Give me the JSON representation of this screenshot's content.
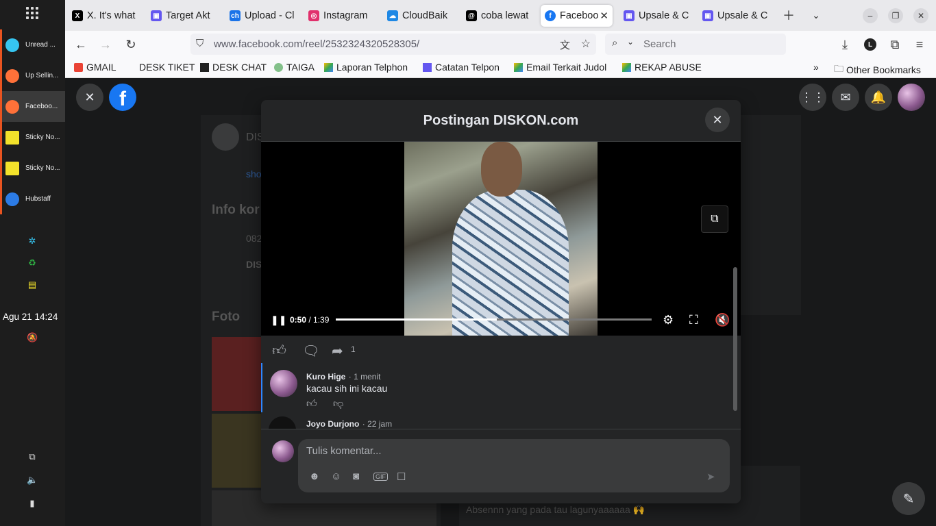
{
  "dock": {
    "windows": [
      {
        "label": "Unread ...",
        "color": "#36c5f0"
      },
      {
        "label": "Up Sellin...",
        "color": "#ff7139"
      },
      {
        "label": "Faceboo...",
        "color": "#ff7139"
      },
      {
        "label": "Sticky No...",
        "color": "#f3e22b"
      },
      {
        "label": "Sticky No...",
        "color": "#f3e22b"
      },
      {
        "label": "Hubstaff",
        "color": "#2c7be5"
      }
    ],
    "clock": "Agu 21  14:24"
  },
  "browser": {
    "tabs": [
      {
        "label": "X. It's what",
        "icon": "X",
        "color": "#000000"
      },
      {
        "label": "Target Akt",
        "icon": "▣",
        "color": "#6457f0"
      },
      {
        "label": "Upload - Cl",
        "icon": "ch",
        "color": "#1a73e8"
      },
      {
        "label": "Instagram",
        "icon": "◎",
        "color": "#e1306c"
      },
      {
        "label": "CloudBaik",
        "icon": "☁",
        "color": "#1e88e5"
      },
      {
        "label": "coba lewat",
        "icon": "@",
        "color": "#000000"
      },
      {
        "label": "Faceboo",
        "icon": "f",
        "color": "#1877f2"
      },
      {
        "label": "Upsale & C",
        "icon": "▣",
        "color": "#6457f0"
      },
      {
        "label": "Upsale & C",
        "icon": "▣",
        "color": "#6457f0"
      }
    ],
    "url_host": "www.facebook.com",
    "url_path": "/reel/2532324320528305/",
    "search_placeholder": "Search",
    "profile_letter": "L",
    "bookmarks": [
      {
        "label": "GMAIL",
        "color": "#ea4335"
      },
      {
        "label": "DESK TIKET",
        "color": "#f9f9fb"
      },
      {
        "label": "DESK CHAT",
        "color": "#222222"
      },
      {
        "label": "TAIGA",
        "color": "#83c08a"
      },
      {
        "label": "Laporan Telphon",
        "color": "#34a853"
      },
      {
        "label": "Catatan Telpon",
        "color": "#6457f0"
      },
      {
        "label": "Email Terkait Judol",
        "color": "#fbbc04"
      },
      {
        "label": "REKAP ABUSE",
        "color": "#34a853"
      }
    ],
    "other_bookmarks": "Other Bookmarks"
  },
  "background_page": {
    "page_short": "DIS",
    "info_title": "Info kor",
    "phone": "082",
    "dis2": "DIS",
    "foto": "Foto",
    "link_text": "sho",
    "snippet": "Absennn yang pada tau lagunyaaaaaa 🙌"
  },
  "modal": {
    "title": "Postingan DISKON.com",
    "video": {
      "current": "0:50",
      "duration": "1:39",
      "progress_fraction": 0.51
    },
    "share_count": "1",
    "comments": [
      {
        "name": "Kuro Hige",
        "time": "· 1 menit",
        "text": "kacau sih ini kacau"
      },
      {
        "name": "Joyo Durjono",
        "time": "· 22 jam",
        "text": ""
      }
    ],
    "composer_placeholder": "Tulis komentar..."
  }
}
